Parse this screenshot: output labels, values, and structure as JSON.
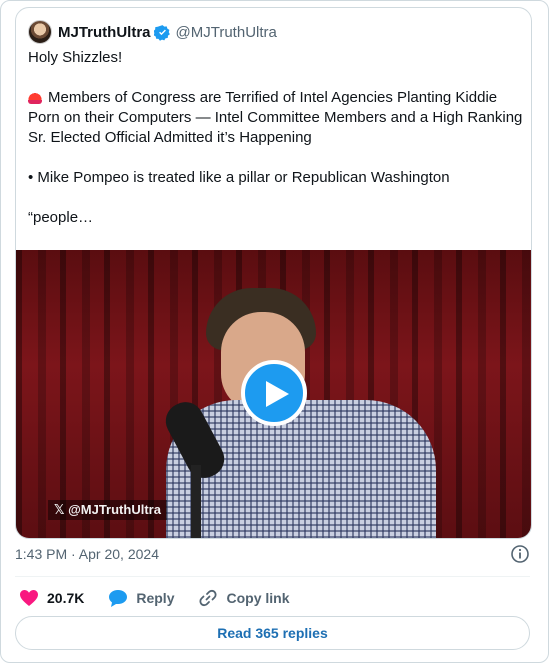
{
  "author": {
    "display_name": "MJTruthUltra",
    "handle": "@MJTruthUltra",
    "verified": true
  },
  "tweet": {
    "lines": [
      "Holy Shizzles!",
      "Members of Congress are Terrified of Intel Agencies Planting Kiddie Porn on their Computers — Intel Committee Members and a High Ranking Sr. Elected Official Admitted it’s Happening",
      "• Mike Pompeo is treated like a pillar or Republican Washington",
      "“people…"
    ],
    "emoji_icon": "siren-icon"
  },
  "media": {
    "watermark": "𝕏 @MJTruthUltra",
    "play_icon": "play-icon",
    "accent": "#1d9bf0"
  },
  "meta": {
    "timestamp": "1:43 PM · Apr 20, 2024",
    "info_icon": "info-icon"
  },
  "actions": {
    "like_count": "20.7K",
    "reply_label": "Reply",
    "copy_label": "Copy link",
    "like_color": "#f91880",
    "reply_color": "#1d9bf0"
  },
  "footer": {
    "read_replies_label": "Read 365 replies"
  }
}
